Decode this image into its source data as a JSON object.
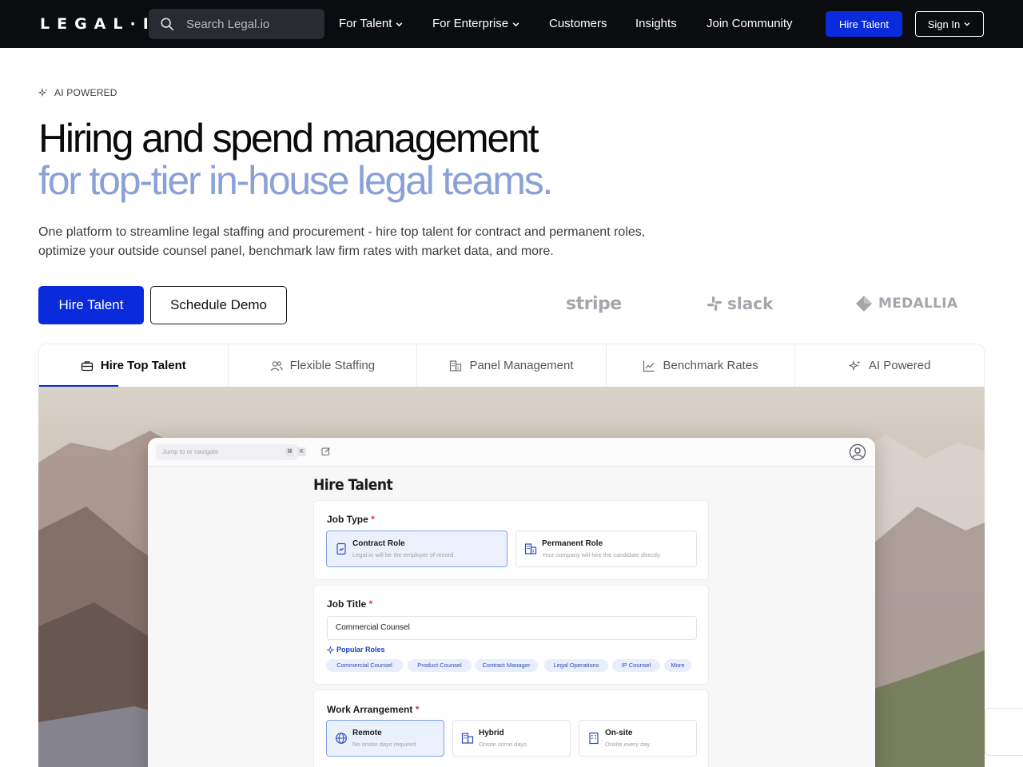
{
  "nav": {
    "logo": "LEGAL·IO",
    "search_placeholder": "Search Legal.io",
    "links": [
      "For Talent",
      "For Enterprise",
      "Customers",
      "Insights",
      "Join Community"
    ],
    "hire_label": "Hire Talent",
    "signin_label": "Sign In"
  },
  "hero": {
    "badge": "AI POWERED",
    "title_line1": "Hiring and spend management",
    "title_line2": "for top-tier in-house legal teams.",
    "lede": "One platform to streamline legal staffing and procurement - hire top talent for contract and permanent roles, optimize your outside counsel panel, benchmark law firm rates with market data, and more.",
    "primary_cta": "Hire Talent",
    "secondary_cta": "Schedule Demo",
    "clients": [
      "stripe",
      "slack",
      "MEDALLIA"
    ]
  },
  "tabs": [
    "Hire Top Talent",
    "Flexible Staffing",
    "Panel Management",
    "Benchmark Rates",
    "AI Powered"
  ],
  "app": {
    "jump_placeholder": "Jump to or navigate",
    "kbd": [
      "⌘",
      "K"
    ],
    "title": "Hire Talent",
    "job_type": {
      "label": "Job Type",
      "options": [
        {
          "title": "Contract Role",
          "sub": "Legal.io will be the employer of record.",
          "selected": true
        },
        {
          "title": "Permanent Role",
          "sub": "Your company will hire the candidate directly.",
          "selected": false
        }
      ]
    },
    "job_title": {
      "label": "Job Title",
      "value": "Commercial Counsel",
      "popular_label": "Popular Roles",
      "chips": [
        "Commercial Counsel",
        "Product Counsel",
        "Contract Manager",
        "Legal Operations",
        "IP Counsel",
        "More"
      ]
    },
    "work_arrangement": {
      "label": "Work Arrangement",
      "options": [
        {
          "title": "Remote",
          "sub": "No onsite days required",
          "selected": true
        },
        {
          "title": "Hybrid",
          "sub": "Onsite some days",
          "selected": false
        },
        {
          "title": "On-site",
          "sub": "Onsite every day",
          "selected": false
        }
      ]
    },
    "required_mark": "*"
  },
  "colors": {
    "brand_blue": "#0a2bdb",
    "title_accent": "#8aa1d6",
    "nav_bg": "#0b0c0f"
  }
}
